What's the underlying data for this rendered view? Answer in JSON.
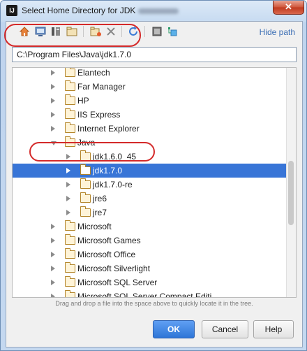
{
  "window": {
    "title": "Select Home Directory for JDK",
    "close_glyph": "✕",
    "icon_label": "IJ"
  },
  "toolbar": {
    "icons": [
      "home-icon",
      "desktop-icon",
      "project-icon",
      "module-icon",
      "new-folder-icon",
      "delete-icon",
      "refresh-icon",
      "show-hidden-icon",
      "bookmark-icon"
    ],
    "hide_path_label": "Hide path"
  },
  "path": {
    "value": "C:\\Program Files\\Java\\jdk1.7.0"
  },
  "tree": {
    "items": [
      {
        "label": "Elantech",
        "depth": 0,
        "expanded": false,
        "selected": false
      },
      {
        "label": "Far Manager",
        "depth": 0,
        "expanded": false,
        "selected": false
      },
      {
        "label": "HP",
        "depth": 0,
        "expanded": false,
        "selected": false
      },
      {
        "label": "IIS Express",
        "depth": 0,
        "expanded": false,
        "selected": false
      },
      {
        "label": "Internet Explorer",
        "depth": 0,
        "expanded": false,
        "selected": false
      },
      {
        "label": "Java",
        "depth": 0,
        "expanded": true,
        "selected": false
      },
      {
        "label": "jdk1.6.0_45",
        "depth": 1,
        "expanded": false,
        "selected": false
      },
      {
        "label": "jdk1.7.0",
        "depth": 1,
        "expanded": false,
        "selected": true
      },
      {
        "label": "jdk1.7.0-re",
        "depth": 1,
        "expanded": false,
        "selected": false
      },
      {
        "label": "jre6",
        "depth": 1,
        "expanded": false,
        "selected": false
      },
      {
        "label": "jre7",
        "depth": 1,
        "expanded": false,
        "selected": false
      },
      {
        "label": "Microsoft",
        "depth": 0,
        "expanded": false,
        "selected": false
      },
      {
        "label": "Microsoft Games",
        "depth": 0,
        "expanded": false,
        "selected": false
      },
      {
        "label": "Microsoft Office",
        "depth": 0,
        "expanded": false,
        "selected": false
      },
      {
        "label": "Microsoft Silverlight",
        "depth": 0,
        "expanded": false,
        "selected": false
      },
      {
        "label": "Microsoft SQL Server",
        "depth": 0,
        "expanded": false,
        "selected": false
      },
      {
        "label": "Microsoft SQL Server Compact Editi",
        "depth": 0,
        "expanded": false,
        "selected": false
      }
    ]
  },
  "hint": "Drag and drop a file into the space above to quickly locate it in the tree.",
  "buttons": {
    "ok": "OK",
    "cancel": "Cancel",
    "help": "Help"
  },
  "colors": {
    "selection": "#3875d7",
    "annotation": "#d42a2a",
    "link": "#3c6fb5"
  }
}
